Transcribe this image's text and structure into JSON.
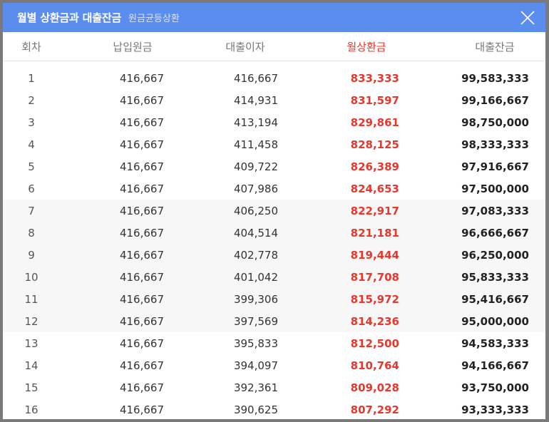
{
  "modal": {
    "title": "월별 상환금과 대출잔금",
    "subtitle": "원금균등상환"
  },
  "colors": {
    "header_bg": "#5b8def",
    "accent_red": "#e8372c"
  },
  "table": {
    "columns": [
      "회차",
      "납입원금",
      "대출이자",
      "월상환금",
      "대출잔금"
    ],
    "rows": [
      [
        "1",
        "416,667",
        "416,667",
        "833,333",
        "99,583,333"
      ],
      [
        "2",
        "416,667",
        "414,931",
        "831,597",
        "99,166,667"
      ],
      [
        "3",
        "416,667",
        "413,194",
        "829,861",
        "98,750,000"
      ],
      [
        "4",
        "416,667",
        "411,458",
        "828,125",
        "98,333,333"
      ],
      [
        "5",
        "416,667",
        "409,722",
        "826,389",
        "97,916,667"
      ],
      [
        "6",
        "416,667",
        "407,986",
        "824,653",
        "97,500,000"
      ],
      [
        "7",
        "416,667",
        "406,250",
        "822,917",
        "97,083,333"
      ],
      [
        "8",
        "416,667",
        "404,514",
        "821,181",
        "96,666,667"
      ],
      [
        "9",
        "416,667",
        "402,778",
        "819,444",
        "96,250,000"
      ],
      [
        "10",
        "416,667",
        "401,042",
        "817,708",
        "95,833,333"
      ],
      [
        "11",
        "416,667",
        "399,306",
        "815,972",
        "95,416,667"
      ],
      [
        "12",
        "416,667",
        "397,569",
        "814,236",
        "95,000,000"
      ],
      [
        "13",
        "416,667",
        "395,833",
        "812,500",
        "94,583,333"
      ],
      [
        "14",
        "416,667",
        "394,097",
        "810,764",
        "94,166,667"
      ],
      [
        "15",
        "416,667",
        "392,361",
        "809,028",
        "93,750,000"
      ],
      [
        "16",
        "416,667",
        "390,625",
        "807,292",
        "93,333,333"
      ]
    ]
  }
}
